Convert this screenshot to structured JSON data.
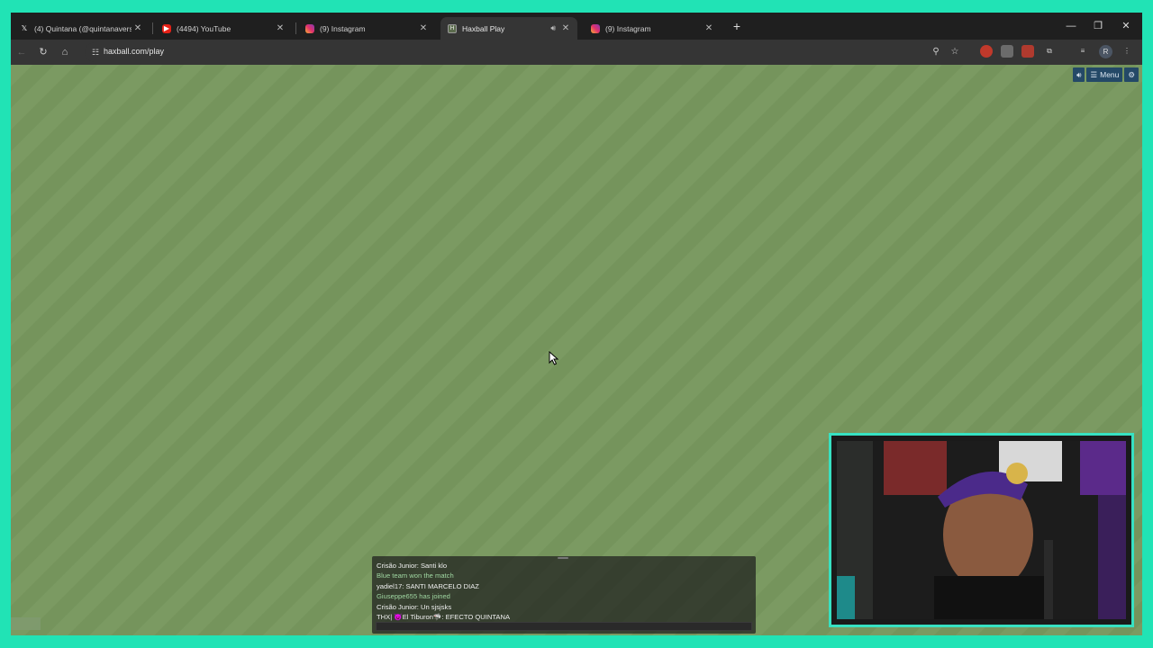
{
  "browser": {
    "tabs": [
      {
        "title": "(4) Quintana (@quintanaverso)",
        "icon": "x-logo-icon",
        "active": false
      },
      {
        "title": "(4494) YouTube",
        "icon": "youtube-icon",
        "active": false
      },
      {
        "title": "(9) Instagram",
        "icon": "instagram-icon",
        "active": false
      },
      {
        "title": "Haxball Play",
        "icon": "haxball-icon",
        "active": true,
        "audio": true
      },
      {
        "title": "(9) Instagram",
        "icon": "instagram-icon",
        "active": false
      }
    ],
    "url": "haxball.com/play"
  },
  "game": {
    "menu_label": "Menu"
  },
  "chat": {
    "lines": [
      {
        "text": "Crisão Junior: Santi klo",
        "kind": "message"
      },
      {
        "text": "Blue team won the match",
        "kind": "notice"
      },
      {
        "text": "yadiel17: SANTI MARCELO DIAZ",
        "kind": "message"
      },
      {
        "text": "Giuseppe655 has joined",
        "kind": "notice"
      },
      {
        "text": "Crisão Junior: Un sjsjsks",
        "kind": "message"
      },
      {
        "text": "THX| 😈El Tiburon🦈: EFECTO QUINTANA",
        "kind": "message"
      }
    ]
  },
  "colors": {
    "overlay_border": "#21e3b5",
    "field_light": "#7b9a62",
    "field_dark": "#75945c",
    "notice_text": "#9fd6a1"
  }
}
